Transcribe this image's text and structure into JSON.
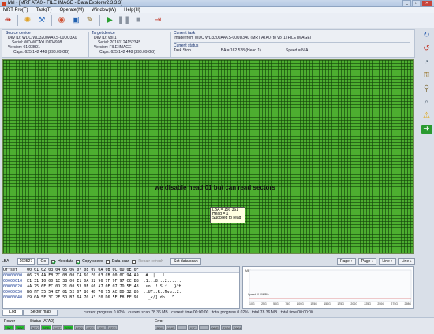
{
  "window": {
    "title": "MrI - [MRT ATA0 - FILE IMAGE - Data Explorer2.3.3.3]"
  },
  "menu": [
    "MRT Pro(F)",
    "Task(T)",
    "Operate(M)",
    "Window(W)",
    "Help(H)"
  ],
  "source": {
    "heading": "Source device",
    "dev_id": "Dev ID: WDC WD3200AAKS-00UU3A0",
    "serial": "Serial: WD-WCAYU0604998",
    "version": "Version: 01.03B01",
    "caps": "Caps: 625 142 448 (298.09 GB)"
  },
  "target": {
    "heading": "Target device",
    "dev_id": "Dev ID: vol 1",
    "serial": "Serial: 20181124152345",
    "version": "Version: FILE IMAGE",
    "caps": "Caps: 625 142 448 (298.09 GB)"
  },
  "task": {
    "heading": "Current task",
    "desc": "Image from WDC WD3200AAKS-00UU3A0 (MRT ATA0) to vol 1 [FILE IMAGE]"
  },
  "status": {
    "heading": "Current status",
    "state": "Task Stop",
    "lba": "LBA = 162 528 (Head 1)",
    "speed": "Speed = N/A"
  },
  "overlay_text": "we disable head 01 but can read sectors",
  "tooltip": {
    "lba": "LBA = 156 361",
    "head": "Head = 1",
    "result": "Succeed to read"
  },
  "lba_bar": {
    "label": "LBA",
    "value": "162527",
    "go": "Go",
    "hex_data": "Hex data",
    "copy_speed": "Copy speed",
    "data_scan": "Data scan",
    "repair": "Repair refresh",
    "set_scan": "Set data scan",
    "page_up": "Page ↑",
    "page_down": "Page ↓",
    "line_up": "Line ↑",
    "line_down": "Line ↓"
  },
  "hex": {
    "header": "Offset    00 01 02 03 04 05 06 07 08 09 0A 0B 0C 0D 0E 0F",
    "rows": [
      {
        "off": "00000000",
        "bytes": "06 23 AA FB 7C 0B 00 C4 6C F0 03 CB 00 0C 94 A9",
        "ascii": ".#..|...l......."
      },
      {
        "off": "00000010",
        "bytes": "E1 31 10 00 1C 38 00 E1 DA 32 96 7F 9F 97 CC BB",
        "ascii": ".1...8...2......"
      },
      {
        "off": "00000020",
        "bytes": "AA 75 6F FC 0D 21 00 53 0E 66 A7 0E 07 7D 5E 48",
        "ascii": ".uo..!.S.f...}^H"
      },
      {
        "off": "00000030",
        "bytes": "B6 FF 55 54 EF 01 52 07 80 4D 76 75 AC DD 32 86",
        "ascii": "..UT..R..Mvu..2."
      },
      {
        "off": "00000040",
        "bytes": "F9 0A 5F 3C 2F 5D B7 64 70 A3 F0 D6 5E F8 FF 91",
        "ascii": ".._</].dp...^..."
      }
    ]
  },
  "speed_chart": {
    "y_label": "MB/s",
    "speed_label": "Speed: 0.00MB/s",
    "x_ticks": [
      "10G",
      "25G",
      "50G",
      "75G",
      "100G",
      "125G",
      "150G",
      "175G",
      "200G",
      "225G",
      "250G",
      "275G",
      "298G"
    ]
  },
  "tabs": [
    "Log",
    "Sector map"
  ],
  "progress": {
    "current_progress": "current progress 0.02%",
    "current_scan": "current scan 78.36 MB",
    "current_time": "current time 00:00:00",
    "total_progress": "total progress 0.02%",
    "total": "total 78.36 MB",
    "total_time": "total time 00:00:00"
  },
  "statusbar": {
    "power_label": "Power",
    "power_leds": [
      "5V",
      "12V"
    ],
    "status_label": "Status (ATA0)",
    "status_leds": [
      "BSY",
      "DRD",
      "DWF",
      "DSC",
      "DRQ",
      "CRR",
      "IDX",
      "ERR"
    ],
    "error_label": "Error",
    "error_leds": [
      "BBK",
      "UNC",
      "",
      "INF",
      "",
      "ABR",
      "TON",
      "AMN"
    ]
  },
  "colors": {
    "map_green": "#4dae30",
    "led_on": "#23c02b"
  }
}
